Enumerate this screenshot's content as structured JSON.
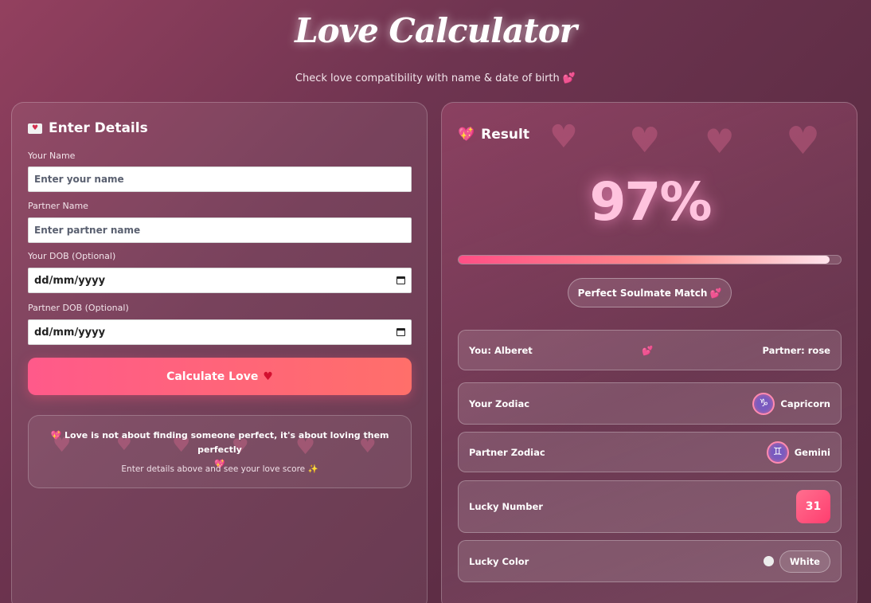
{
  "header": {
    "title": "Love Calculator",
    "subtitle": "Check love compatibility with name & date of birth",
    "subtitle_emoji": "💕"
  },
  "form": {
    "panel_title": "Enter Details",
    "your_name_label": "Your Name",
    "your_name_placeholder": "Enter your name",
    "partner_name_label": "Partner Name",
    "partner_name_placeholder": "Enter partner name",
    "your_dob_label": "Your DOB (Optional)",
    "your_dob_value": "dd/mm/yyyy",
    "partner_dob_label": "Partner DOB (Optional)",
    "partner_dob_value": "dd/mm/yyyy",
    "calculate_label": "Calculate Love",
    "calculate_emoji": "♥"
  },
  "quote": {
    "emoji_start": "💖",
    "text": "Love is not about finding someone perfect, it's about loving them perfectly",
    "emoji_end": "💖",
    "hint": "Enter details above and see your love score",
    "hint_emoji": "✨"
  },
  "result": {
    "panel_title": "Result",
    "title_emoji": "💖",
    "percent_text": "97%",
    "percent_value": 97,
    "match_label": "Perfect Soulmate Match",
    "match_emoji": "💕",
    "you": "You: Alberet",
    "couple_emoji": "💕",
    "partner": "Partner: rose",
    "your_zodiac_label": "Your Zodiac",
    "your_zodiac_symbol": "♑",
    "your_zodiac": "Capricorn",
    "partner_zodiac_label": "Partner Zodiac",
    "partner_zodiac_symbol": "♊",
    "partner_zodiac": "Gemini",
    "lucky_number_label": "Lucky Number",
    "lucky_number": "31",
    "lucky_color_label": "Lucky Color",
    "lucky_color": "White",
    "lucky_color_hex": "#ececec"
  },
  "colors": {
    "accent_pink": "#ff5a8a",
    "percent_pink": "#ffc3de"
  }
}
